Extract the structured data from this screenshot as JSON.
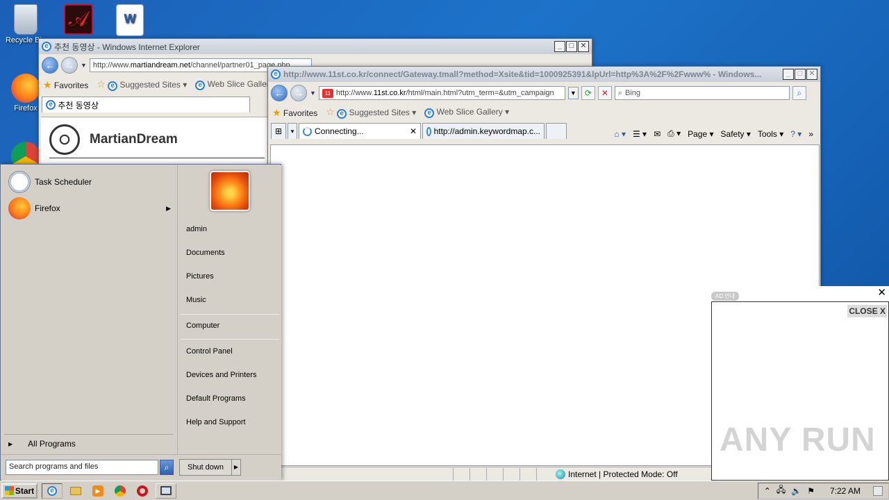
{
  "desktop": {
    "icons": [
      {
        "label": "Recycle Bin"
      },
      {
        "label": ""
      },
      {
        "label": ""
      },
      {
        "label": "Firefox"
      },
      {
        "label": ""
      }
    ]
  },
  "ie_back": {
    "title": "추천 동영상 - Windows Internet Explorer",
    "address_prefix": "http://www.",
    "address_host": "martiandream.net",
    "address_rest": "/channel/partner01_page.php",
    "search_placeholder": "Bing",
    "favorites_label": "Favorites",
    "suggested_sites": "Suggested Sites",
    "web_slice": "Web Slice Gallery",
    "tab_label": "추천 동영상",
    "logo_text": "MartianDream"
  },
  "ie_front": {
    "title": "http://www.11st.co.kr/connect/Gateway.tmall?method=Xsite&tid=1000925391&lpUrl=http%3A%2F%2Fwww% - Windows...",
    "address_prefix": "http://www.",
    "address_host": "11st.co.kr",
    "address_rest": "/html/main.html?utm_term=&utm_campaign",
    "search_placeholder": "Bing",
    "favorites_label": "Favorites",
    "suggested_sites": "Suggested Sites",
    "web_slice": "Web Slice Gallery",
    "tabs": [
      {
        "label": "Connecting..."
      },
      {
        "label": "http://admin.keywordmap.c..."
      }
    ],
    "cmd_page": "Page",
    "cmd_safety": "Safety",
    "cmd_tools": "Tools",
    "status_zone": "Internet | Protected Mode: Off"
  },
  "start_menu": {
    "programs": [
      {
        "label": "Task Scheduler"
      },
      {
        "label": "Firefox"
      }
    ],
    "all_programs": "All Programs",
    "search_placeholder": "Search programs and files",
    "right_items": {
      "user": "admin",
      "documents": "Documents",
      "pictures": "Pictures",
      "music": "Music",
      "computer": "Computer",
      "control_panel": "Control Panel",
      "devices": "Devices and Printers",
      "default_programs": "Default Programs",
      "help": "Help and Support"
    },
    "shutdown": "Shut down"
  },
  "ad_popup": {
    "tag": "AD 안내",
    "close_label": "CLOSE X"
  },
  "watermark": "ANY RUN",
  "taskbar": {
    "start_label": "Start",
    "clock": "7:22 AM"
  },
  "colors": {
    "desktop": "#1b5fb8",
    "ie_blue": "#2b7ed8",
    "menu_bg": "#d4d0c8"
  }
}
